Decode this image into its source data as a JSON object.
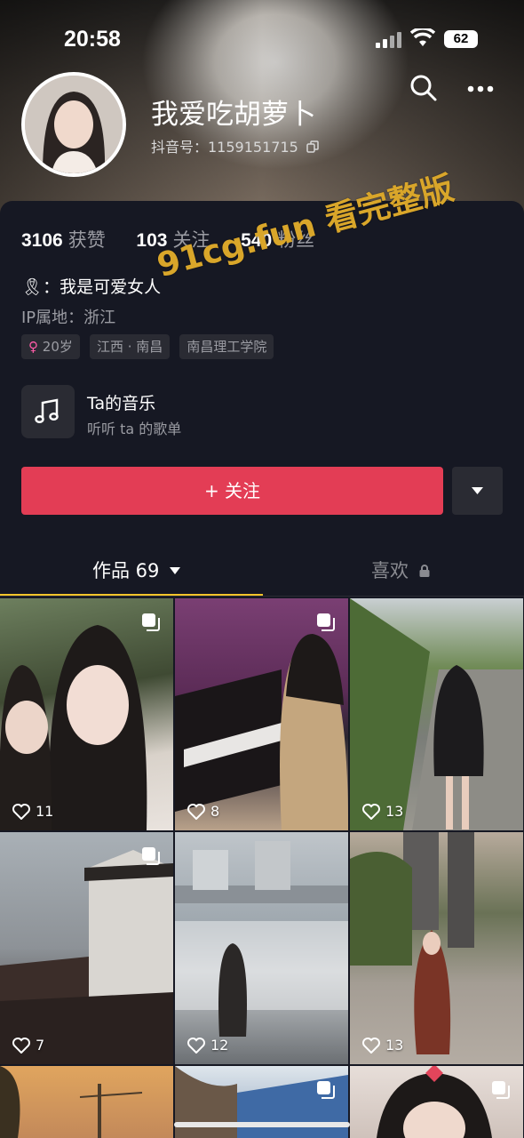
{
  "status_bar": {
    "time": "20:58",
    "battery": "62"
  },
  "profile": {
    "name": "我爱吃胡萝卜",
    "douyin_id": "抖音号：1159151715",
    "stats": [
      {
        "value": "3106",
        "label": "获赞"
      },
      {
        "value": "103",
        "label": "关注"
      },
      {
        "value": "540",
        "label": "粉丝"
      }
    ],
    "bio": "🎗：我是可爱女人",
    "ip_location": "IP属地：浙江",
    "tags": [
      {
        "icon": "female-icon",
        "label": "20岁"
      },
      {
        "label": "江西 · 南昌"
      },
      {
        "label": "南昌理工学院"
      }
    ]
  },
  "music": {
    "title": "Ta的音乐",
    "subtitle": "听听 ta 的歌单"
  },
  "actions": {
    "follow_label": "+ 关注"
  },
  "tabs": [
    {
      "label": "作品 69",
      "active": true
    },
    {
      "label": "喜欢",
      "locked": true
    }
  ],
  "watermark": "91cg.fun 看完整版",
  "grid": [
    {
      "likes": "11",
      "multi": true
    },
    {
      "likes": "8",
      "multi": true
    },
    {
      "likes": "13",
      "multi": false
    },
    {
      "likes": "7",
      "multi": true
    },
    {
      "likes": "12",
      "multi": false
    },
    {
      "likes": "13",
      "multi": false
    },
    {
      "likes": "",
      "multi": false
    },
    {
      "likes": "",
      "multi": true
    },
    {
      "likes": "",
      "multi": true
    }
  ],
  "colors": {
    "accent": "#e33d55",
    "tab_indicator": "#f4c42a",
    "background": "#161823"
  }
}
